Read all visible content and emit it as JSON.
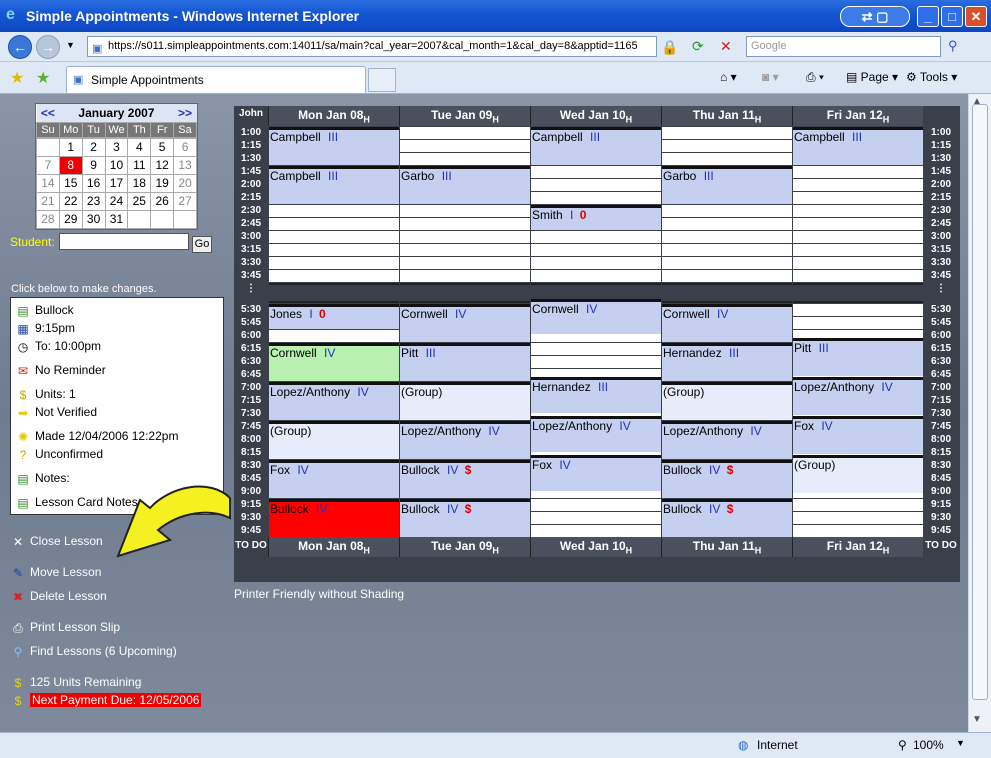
{
  "window": {
    "title": "Simple Appointments - Windows Internet Explorer"
  },
  "address": {
    "url": "https://s011.simpleappointments.com:14011/sa/main?cal_year=2007&cal_month=1&cal_day=8&apptid=1165",
    "search_placeholder": "Google"
  },
  "tab": {
    "label": "Simple Appointments"
  },
  "toolbar": {
    "page": "Page",
    "tools": "Tools"
  },
  "status": {
    "zone": "Internet",
    "zoom": "100%"
  },
  "mini_calendar": {
    "title": "January 2007",
    "prev": "<<",
    "next": ">>",
    "dow": [
      "Su",
      "Mo",
      "Tu",
      "We",
      "Th",
      "Fr",
      "Sa"
    ],
    "weeks": [
      [
        "",
        "",
        "1",
        "2",
        "3",
        "4",
        "5",
        "6"
      ],
      [
        "7",
        "8",
        "9",
        "10",
        "11",
        "12",
        "13"
      ],
      [
        "14",
        "15",
        "16",
        "17",
        "18",
        "19",
        "20"
      ],
      [
        "21",
        "22",
        "23",
        "24",
        "25",
        "26",
        "27"
      ],
      [
        "28",
        "29",
        "30",
        "31",
        "",
        "",
        ""
      ]
    ]
  },
  "student": {
    "label": "Student:",
    "go": "Go",
    "value": ""
  },
  "details": {
    "hint": "Click below to make changes.",
    "name": "Bullock",
    "time": "9:15pm",
    "to": "To: 10:00pm",
    "reminder": "No Reminder",
    "units": "Units: 1",
    "verified": "Not Verified",
    "made": "Made 12/04/2006 12:22pm",
    "confirmed": "Unconfirmed",
    "notes": "Notes:",
    "card_notes": "Lesson Card Notes:"
  },
  "actions": {
    "close": "Close Lesson",
    "move": "Move Lesson",
    "delete": "Delete Lesson",
    "print": "Print Lesson Slip",
    "find": "Find Lessons (6 Upcoming)",
    "remaining": "125 Units Remaining",
    "payment": "Next Payment Due: 12/05/2006"
  },
  "schedule": {
    "corner": "John",
    "todo": "TO DO",
    "footer_link": "Printer Friendly without Shading",
    "days": [
      "Mon Jan 08",
      "Tue Jan 09",
      "Wed Jan 10",
      "Thu Jan 11",
      "Fri Jan 12"
    ],
    "holiday_mark": "H",
    "times": [
      "1:00",
      "1:15",
      "1:30",
      "1:45",
      "2:00",
      "2:15",
      "2:30",
      "2:45",
      "3:00",
      "3:15",
      "3:30",
      "3:45",
      "⋮",
      "5:30",
      "5:45",
      "6:00",
      "6:15",
      "6:30",
      "6:45",
      "7:00",
      "7:15",
      "7:30",
      "7:45",
      "8:00",
      "8:15",
      "8:30",
      "8:45",
      "9:00",
      "9:15",
      "9:30",
      "9:45"
    ],
    "appointments": [
      {
        "day": 0,
        "row": 0,
        "span": 3,
        "name": "Campbell",
        "level": "III",
        "style": "blue"
      },
      {
        "day": 0,
        "row": 3,
        "span": 3,
        "name": "Campbell",
        "level": "III",
        "style": "blue"
      },
      {
        "day": 0,
        "row": 13,
        "span": 2,
        "name": "Jones",
        "level": "I",
        "extra": "0",
        "style": "blue"
      },
      {
        "day": 0,
        "row": 16,
        "span": 3,
        "name": "Cornwell",
        "level": "IV",
        "style": "green"
      },
      {
        "day": 0,
        "row": 19,
        "span": 3,
        "name": "Lopez/Anthony",
        "level": "IV",
        "style": "blue"
      },
      {
        "day": 0,
        "row": 22,
        "span": 3,
        "name": "(Group)",
        "level": "",
        "style": "light"
      },
      {
        "day": 0,
        "row": 25,
        "span": 3,
        "name": "Fox",
        "level": "IV",
        "style": "blue"
      },
      {
        "day": 0,
        "row": 28,
        "span": 3,
        "name": "Bullock",
        "level": "IV",
        "style": "red"
      },
      {
        "day": 1,
        "row": 3,
        "span": 3,
        "name": "Garbo",
        "level": "III",
        "style": "blue"
      },
      {
        "day": 1,
        "row": 13,
        "span": 3,
        "name": "Cornwell",
        "level": "IV",
        "style": "blue"
      },
      {
        "day": 1,
        "row": 16,
        "span": 3,
        "name": "Pitt",
        "level": "III",
        "style": "blue"
      },
      {
        "day": 1,
        "row": 19,
        "span": 3,
        "name": "(Group)",
        "level": "",
        "style": "light"
      },
      {
        "day": 1,
        "row": 22,
        "span": 3,
        "name": "Lopez/Anthony",
        "level": "IV",
        "style": "blue"
      },
      {
        "day": 1,
        "row": 25,
        "span": 3,
        "name": "Bullock",
        "level": "IV",
        "extra": "$",
        "style": "blue"
      },
      {
        "day": 1,
        "row": 28,
        "span": 3,
        "name": "Bullock",
        "level": "IV",
        "extra": "$",
        "style": "blue"
      },
      {
        "day": 2,
        "row": 0,
        "span": 3,
        "name": "Campbell",
        "level": "III",
        "style": "blue"
      },
      {
        "day": 2,
        "row": 6,
        "span": 2,
        "name": "Smith",
        "level": "I",
        "extra": "0",
        "style": "blue"
      },
      {
        "day": 2,
        "row": 12.6,
        "span": 2.8,
        "name": "Cornwell",
        "level": "IV",
        "style": "blue"
      },
      {
        "day": 2,
        "row": 18.6,
        "span": 2.9,
        "name": "Hernandez",
        "level": "III",
        "style": "blue"
      },
      {
        "day": 2,
        "row": 21.6,
        "span": 2.9,
        "name": "Lopez/Anthony",
        "level": "IV",
        "style": "blue"
      },
      {
        "day": 2,
        "row": 24.6,
        "span": 2.9,
        "name": "Fox",
        "level": "IV",
        "style": "blue"
      },
      {
        "day": 3,
        "row": 3,
        "span": 3,
        "name": "Garbo",
        "level": "III",
        "style": "blue"
      },
      {
        "day": 3,
        "row": 13,
        "span": 3,
        "name": "Cornwell",
        "level": "IV",
        "style": "blue"
      },
      {
        "day": 3,
        "row": 16,
        "span": 3,
        "name": "Hernandez",
        "level": "III",
        "style": "blue"
      },
      {
        "day": 3,
        "row": 19,
        "span": 3,
        "name": "(Group)",
        "level": "",
        "style": "light"
      },
      {
        "day": 3,
        "row": 22,
        "span": 3,
        "name": "Lopez/Anthony",
        "level": "IV",
        "style": "blue"
      },
      {
        "day": 3,
        "row": 25,
        "span": 3,
        "name": "Bullock",
        "level": "IV",
        "extra": "$",
        "style": "blue"
      },
      {
        "day": 3,
        "row": 28,
        "span": 3,
        "name": "Bullock",
        "level": "IV",
        "extra": "$",
        "style": "blue"
      },
      {
        "day": 4,
        "row": 0,
        "span": 3,
        "name": "Campbell",
        "level": "III",
        "style": "blue"
      },
      {
        "day": 4,
        "row": 15.6,
        "span": 3,
        "name": "Pitt",
        "level": "III",
        "style": "blue"
      },
      {
        "day": 4,
        "row": 18.6,
        "span": 3,
        "name": "Lopez/Anthony",
        "level": "IV",
        "style": "blue"
      },
      {
        "day": 4,
        "row": 21.6,
        "span": 3,
        "name": "Fox",
        "level": "IV",
        "style": "blue"
      },
      {
        "day": 4,
        "row": 24.6,
        "span": 3,
        "name": "(Group)",
        "level": "",
        "style": "light"
      }
    ]
  },
  "colors": {
    "appt_blue": "#c5d0f0",
    "appt_green": "#b8f0b0",
    "appt_red": "#ff0000",
    "appt_light": "#e8ecfa",
    "level_text": "#2030c0",
    "extra_text": "#e00000",
    "header_bg": "#3a3f4a"
  }
}
